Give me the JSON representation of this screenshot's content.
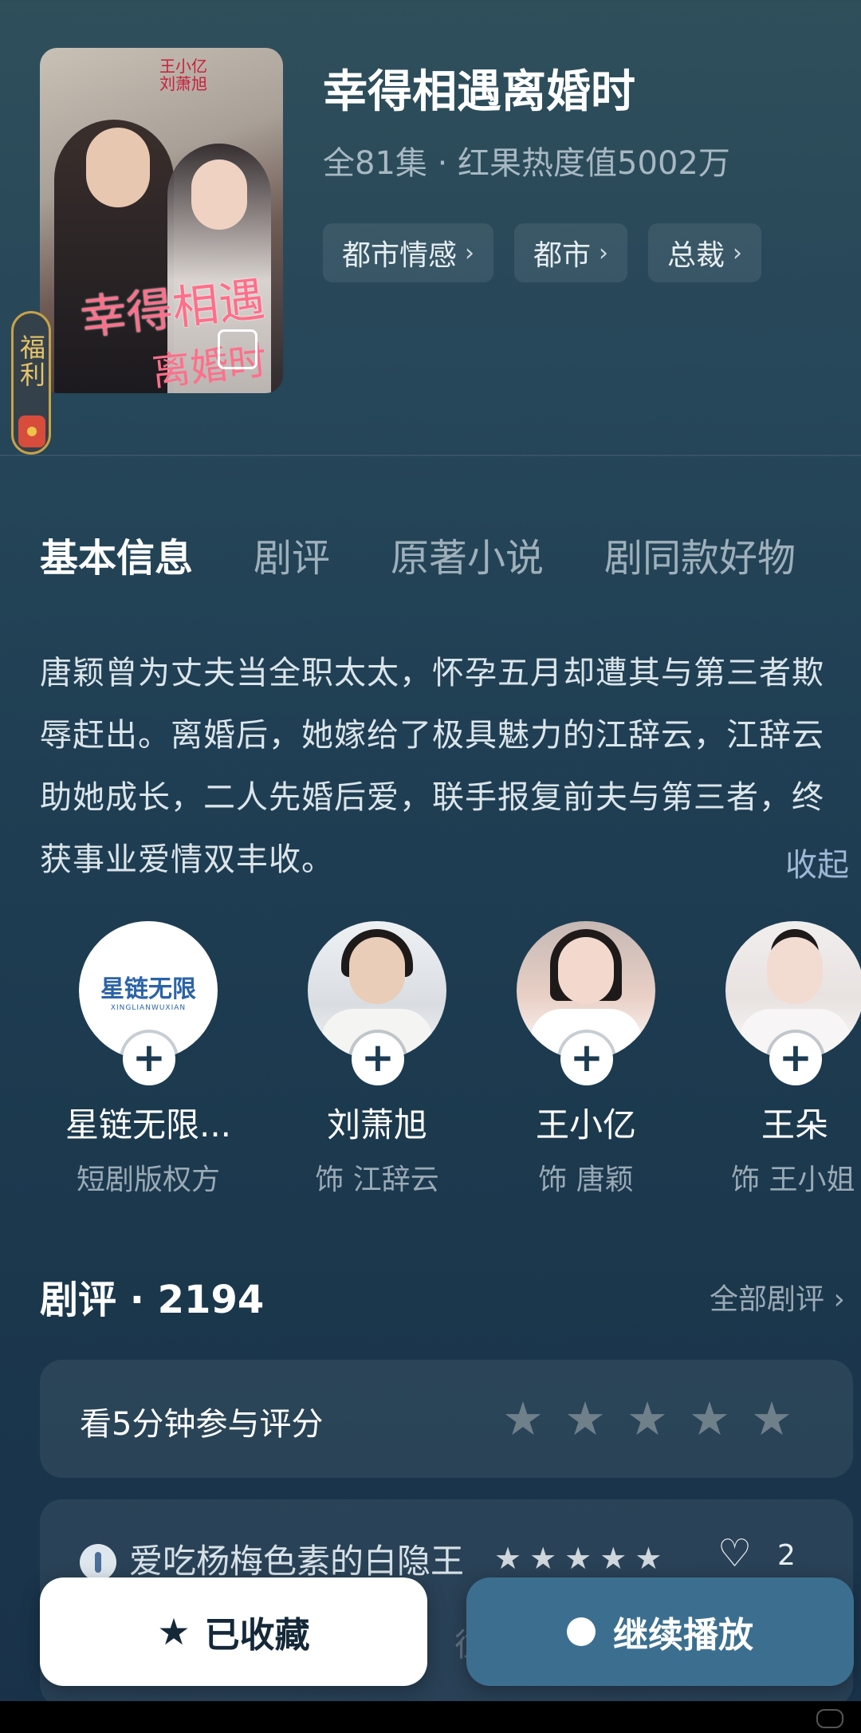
{
  "drama": {
    "title": "幸得相遇离婚时",
    "meta": "全81集 · 红果热度值5002万",
    "poster_title_line1": "幸得相遇",
    "poster_title_line2": "离婚时",
    "poster_names": "王小亿\n刘萧旭",
    "tags": [
      "都市情感",
      "都市",
      "总裁"
    ],
    "welfare_label": "福利"
  },
  "tabs": [
    "基本信息",
    "剧评",
    "原著小说",
    "剧同款好物"
  ],
  "synopsis": {
    "text": "唐颖曾为丈夫当全职太太，怀孕五月却遭其与第三者欺辱赶出。离婚后，她嫁给了极具魅力的江辞云，江辞云助她成长，二人先婚后爱，联手报复前夫与第三者，终获事业爱情双丰收。",
    "collapse": "收起"
  },
  "cast": [
    {
      "name": "星链无限...",
      "role": "短剧版权方",
      "logo_text": "星链无限",
      "logo_sub": "XINGLIANWUXIAN"
    },
    {
      "name": "刘萧旭",
      "role": "饰 江辞云"
    },
    {
      "name": "王小亿",
      "role": "饰 唐颖"
    },
    {
      "name": "王朵",
      "role": "饰 王小姐"
    }
  ],
  "reviews": {
    "heading": "剧评 · 2194",
    "all_link": "全部剧评 ›",
    "rate_prompt": "看5分钟参与评分",
    "first_review": {
      "user": "爱吃杨梅色素的白隐王",
      "stars": 5,
      "likes": "2",
      "faded_text": "往"
    }
  },
  "actions": {
    "favorite": "已收藏",
    "play": "继续播放"
  },
  "colors": {
    "accent": "#3c6f8f",
    "gold": "#e7c46a"
  }
}
